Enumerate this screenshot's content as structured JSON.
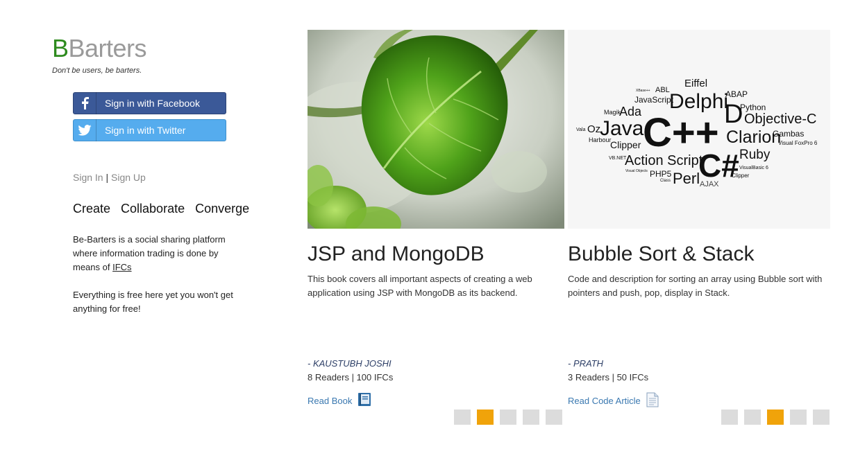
{
  "brand": {
    "logo_initial": "B",
    "logo_rest": "Barters",
    "tagline": "Don't be users, be barters.",
    "accent": "#2e8b1e"
  },
  "auth": {
    "facebook_label": "Sign in with Facebook",
    "twitter_label": "Sign in with Twitter",
    "sign_in": "Sign In",
    "separator": "|",
    "sign_up": "Sign Up"
  },
  "pillars": [
    "Create",
    "Collaborate",
    "Converge"
  ],
  "about": {
    "line1_prefix": "Be-Barters is a social sharing platform where information trading is done by means of ",
    "ifc_link": "IFCs",
    "line2": "Everything is free here yet you won't get anything for free!"
  },
  "cards": [
    {
      "title": "JSP and MongoDB",
      "description": "This book covers all important aspects of creating a web application using JSP with MongoDB as its backend.",
      "author": "- KAUSTUBH JOSHI",
      "stats": "8 Readers | 100 IFCs",
      "action": "Read Book",
      "action_icon": "book-icon",
      "image": "green-leaf-photo",
      "pager_total": 5,
      "pager_active": 2
    },
    {
      "title": "Bubble Sort & Stack",
      "description": "Code and description for sorting an array using Bubble sort with pointers and push, pop, display in Stack.",
      "author": "- PRATH",
      "stats": "3 Readers | 50 IFCs",
      "action": "Read Code Article",
      "action_icon": "document-icon",
      "image": "programming-languages-word-cloud",
      "image_words": [
        "Eiffel",
        "XBase++",
        "ABL",
        "JavaScript",
        "Delphi",
        "ABAP",
        "Python",
        "Magik",
        "Ada",
        "D",
        "Objective-C",
        "Vala",
        "Oz",
        "Java",
        "C++",
        "Clarion",
        "Gambas",
        "Harbour",
        "Clipper",
        "Visual FoxPro 6",
        "VB.NET",
        "Action Script",
        "C#",
        "Ruby",
        "Visual Objects",
        "PHP5",
        "Class",
        "Perl",
        "AJAX",
        "VisualBasic 6",
        "Clipper"
      ],
      "pager_total": 5,
      "pager_active": 3
    }
  ],
  "colors": {
    "pager_active": "#f0a30a",
    "pager_inactive": "#dcdcdc",
    "facebook": "#3b5998",
    "twitter": "#55acee",
    "link": "#3a78b0"
  }
}
